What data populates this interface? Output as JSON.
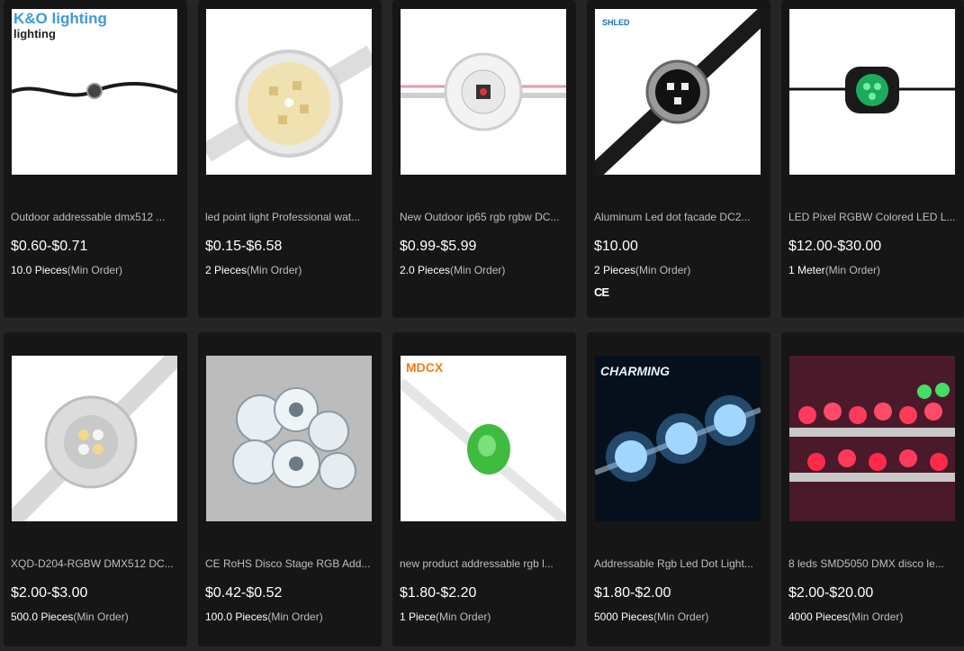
{
  "min_order_label": "(Min Order)",
  "products": [
    {
      "title": "Outdoor addressable dmx512 ...",
      "price": "$0.60-$0.71",
      "moq_qty": "10.0 Pieces",
      "brand": "K&O lighting",
      "image": "black-cable-pixel"
    },
    {
      "title": "led point light Professional wat...",
      "price": "$0.15-$6.58",
      "moq_qty": "2 Pieces",
      "image": "yellow-dot-module"
    },
    {
      "title": "New Outdoor ip65 rgb rgbw DC...",
      "price": "$0.99-$5.99",
      "moq_qty": "2.0 Pieces",
      "image": "clear-pixel-module"
    },
    {
      "title": "Aluminum Led dot facade DC2...",
      "price": "$10.00",
      "moq_qty": "2 Pieces",
      "brand": "SHLED",
      "cert": "CE",
      "image": "aluminum-dot"
    },
    {
      "title": "LED Pixel RGBW Colored LED L...",
      "price": "$12.00-$30.00",
      "moq_qty": "1 Meter",
      "image": "green-pixel"
    },
    {
      "title": "XQD-D204-RGBW DMX512 DC...",
      "price": "$2.00-$3.00",
      "moq_qty": "500.0 Pieces",
      "image": "rgbw-module"
    },
    {
      "title": "CE RoHS Disco Stage RGB Add...",
      "price": "$0.42-$0.52",
      "moq_qty": "100.0 Pieces",
      "image": "dome-cluster"
    },
    {
      "title": "new product addressable rgb l...",
      "price": "$1.80-$2.20",
      "moq_qty": "1 Piece",
      "brand": "MDCX",
      "image": "green-clip"
    },
    {
      "title": "Addressable Rgb Led Dot Light...",
      "price": "$1.80-$2.00",
      "moq_qty": "5000 Pieces",
      "brand": "CHARMING",
      "image": "blue-dot-lights"
    },
    {
      "title": "8 leds SMD5050 DMX disco le...",
      "price": "$2.00-$20.00",
      "moq_qty": "4000 Pieces",
      "image": "red-dome-rack"
    }
  ]
}
